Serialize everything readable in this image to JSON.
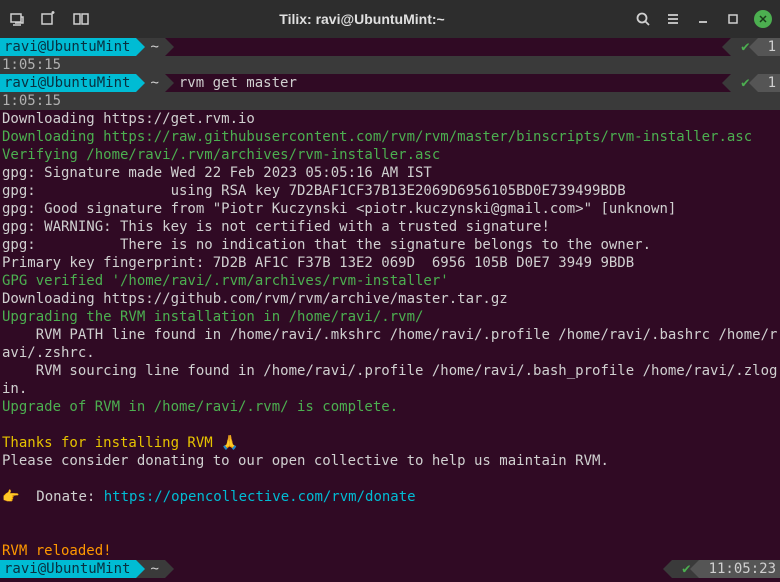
{
  "titlebar": {
    "title": "Tilix: ravi@UbuntuMint:~"
  },
  "prompts": {
    "user": "ravi@UbuntuMint",
    "path": "~",
    "status_check": "✔",
    "exit_code": "1",
    "cmd2": "rvm get master",
    "time3": "11:05:23"
  },
  "timestamps": {
    "t1": "1:05:15",
    "t2": "1:05:15"
  },
  "lines": {
    "l1": "Downloading https://get.rvm.io",
    "l2": "Downloading https://raw.githubusercontent.com/rvm/rvm/master/binscripts/rvm-installer.asc",
    "l3": "Verifying /home/ravi/.rvm/archives/rvm-installer.asc",
    "l4": "gpg: Signature made Wed 22 Feb 2023 05:05:16 AM IST",
    "l5": "gpg:                using RSA key 7D2BAF1CF37B13E2069D6956105BD0E739499BDB",
    "l6": "gpg: Good signature from \"Piotr Kuczynski <piotr.kuczynski@gmail.com>\" [unknown]",
    "l7": "gpg: WARNING: This key is not certified with a trusted signature!",
    "l8": "gpg:          There is no indication that the signature belongs to the owner.",
    "l9": "Primary key fingerprint: 7D2B AF1C F37B 13E2 069D  6956 105B D0E7 3949 9BDB",
    "l10": "GPG verified '/home/ravi/.rvm/archives/rvm-installer'",
    "l11": "Downloading https://github.com/rvm/rvm/archive/master.tar.gz",
    "l12": "Upgrading the RVM installation in /home/ravi/.rvm/",
    "l13": "    RVM PATH line found in /home/ravi/.mkshrc /home/ravi/.profile /home/ravi/.bashrc /home/ravi/.zshrc.",
    "l14": "    RVM sourcing line found in /home/ravi/.profile /home/ravi/.bash_profile /home/ravi/.zlogin.",
    "l15": "Upgrade of RVM in /home/ravi/.rvm/ is complete.",
    "l16a": "Thanks for installing RVM ",
    "l16b": "🙏",
    "l17": "Please consider donating to our open collective to help us maintain RVM.",
    "l18a": "👉  ",
    "l18b": "Donate: ",
    "l18c": "https://opencollective.com/rvm/donate",
    "l19": "RVM reloaded!"
  }
}
